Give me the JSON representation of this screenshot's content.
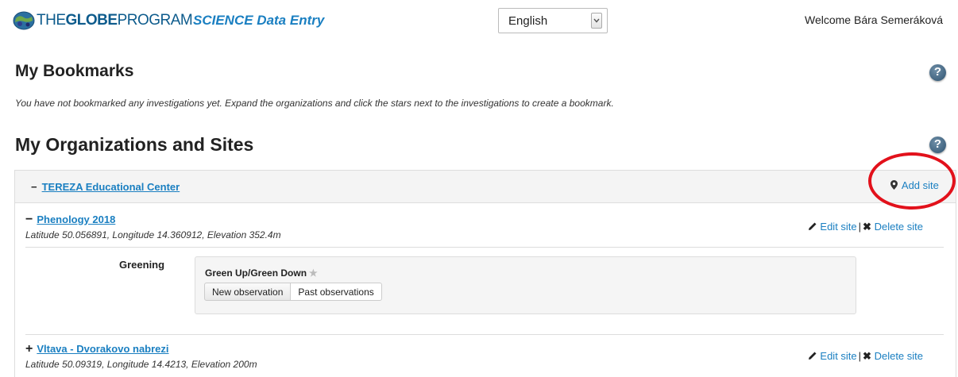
{
  "header": {
    "logo_the": "THE",
    "logo_globe": "GLOBE",
    "logo_program": "PROGRAM",
    "app_title": "SCIENCE Data Entry",
    "language": "English",
    "welcome": "Welcome Bára Semeráková"
  },
  "bookmarks": {
    "title": "My Bookmarks",
    "message": "You have not bookmarked any investigations yet. Expand the organizations and click the stars next to the investigations to create a bookmark."
  },
  "organizations": {
    "title": "My Organizations and Sites",
    "org_name": "TEREZA Educational Center",
    "add_site": "Add site",
    "sites": [
      {
        "name": "Phenology 2018",
        "coords": "Latitude 50.056891, Longitude 14.360912, Elevation 352.4m",
        "edit": "Edit site",
        "delete": "Delete site",
        "protocol_label": "Greening",
        "investigation": "Green Up/Green Down",
        "new_obs": "New observation",
        "past_obs": "Past observations"
      },
      {
        "name": "Vltava - Dvorakovo nabrezi",
        "coords": "Latitude 50.09319, Longitude 14.4213, Elevation 200m",
        "edit": "Edit site",
        "delete": "Delete site"
      }
    ]
  },
  "colors": {
    "link": "#1a7fc1",
    "highlight": "#e2111b",
    "logo": "#0d5b8c"
  }
}
